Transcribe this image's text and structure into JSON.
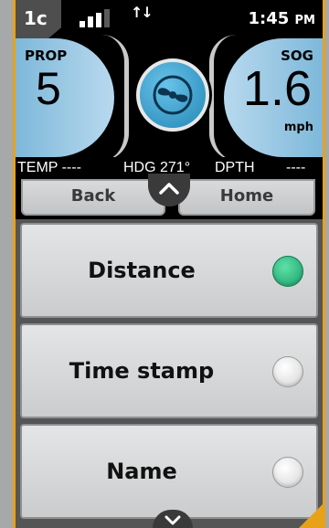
{
  "status_bar": {
    "unit_id": "1c",
    "signal_bars_active": 3,
    "signal_bars_total": 4,
    "clock_time": "1:45",
    "clock_period": "PM"
  },
  "gauges": {
    "prop_label": "PROP",
    "prop_value": "5",
    "sog_label": "SOG",
    "sog_value": "1.6",
    "sog_unit": "mph"
  },
  "info_strip": {
    "temp": "TEMP ----",
    "heading": "HDG 271°",
    "depth_label": "DPTH",
    "depth_value": "----"
  },
  "nav": {
    "back_label": "Back",
    "home_label": "Home"
  },
  "options": [
    {
      "label": "Distance",
      "selected": true
    },
    {
      "label": "Time stamp",
      "selected": false
    },
    {
      "label": "Name",
      "selected": false
    }
  ],
  "colors": {
    "accent_frame": "#e7a21a",
    "gauge_blue": "#7eb8da",
    "selected_green": "#18a06a"
  },
  "icons": [
    "signal-bars-icon",
    "data-transfer-icon",
    "propeller-icon",
    "chevron-up-icon",
    "chevron-down-icon"
  ]
}
